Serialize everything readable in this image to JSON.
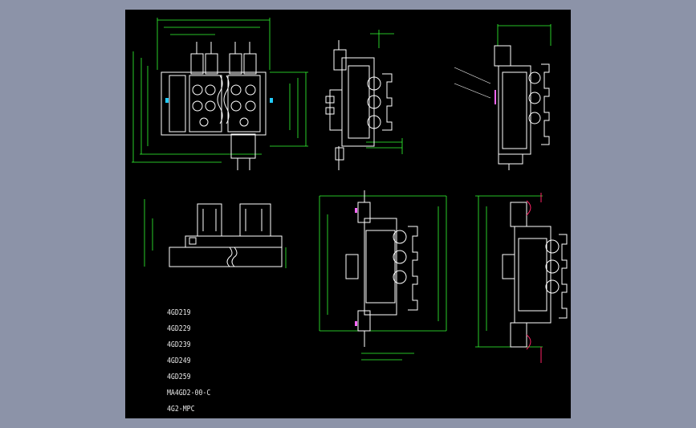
{
  "drawing": {
    "background": "#000000",
    "viewer_background": "#8c93a8",
    "colors": {
      "outline": "#ffffff",
      "dimension": "#33ff33",
      "detail_dim": "#66ff66",
      "highlight": "#ff2266",
      "accent": "#ff66ff",
      "text": "#e6e6e6"
    }
  },
  "models": [
    "4GD219",
    "4GD229",
    "4GD239",
    "4GD249",
    "4GD259",
    "MA4GD2-00-C",
    "4G2-MPC"
  ]
}
